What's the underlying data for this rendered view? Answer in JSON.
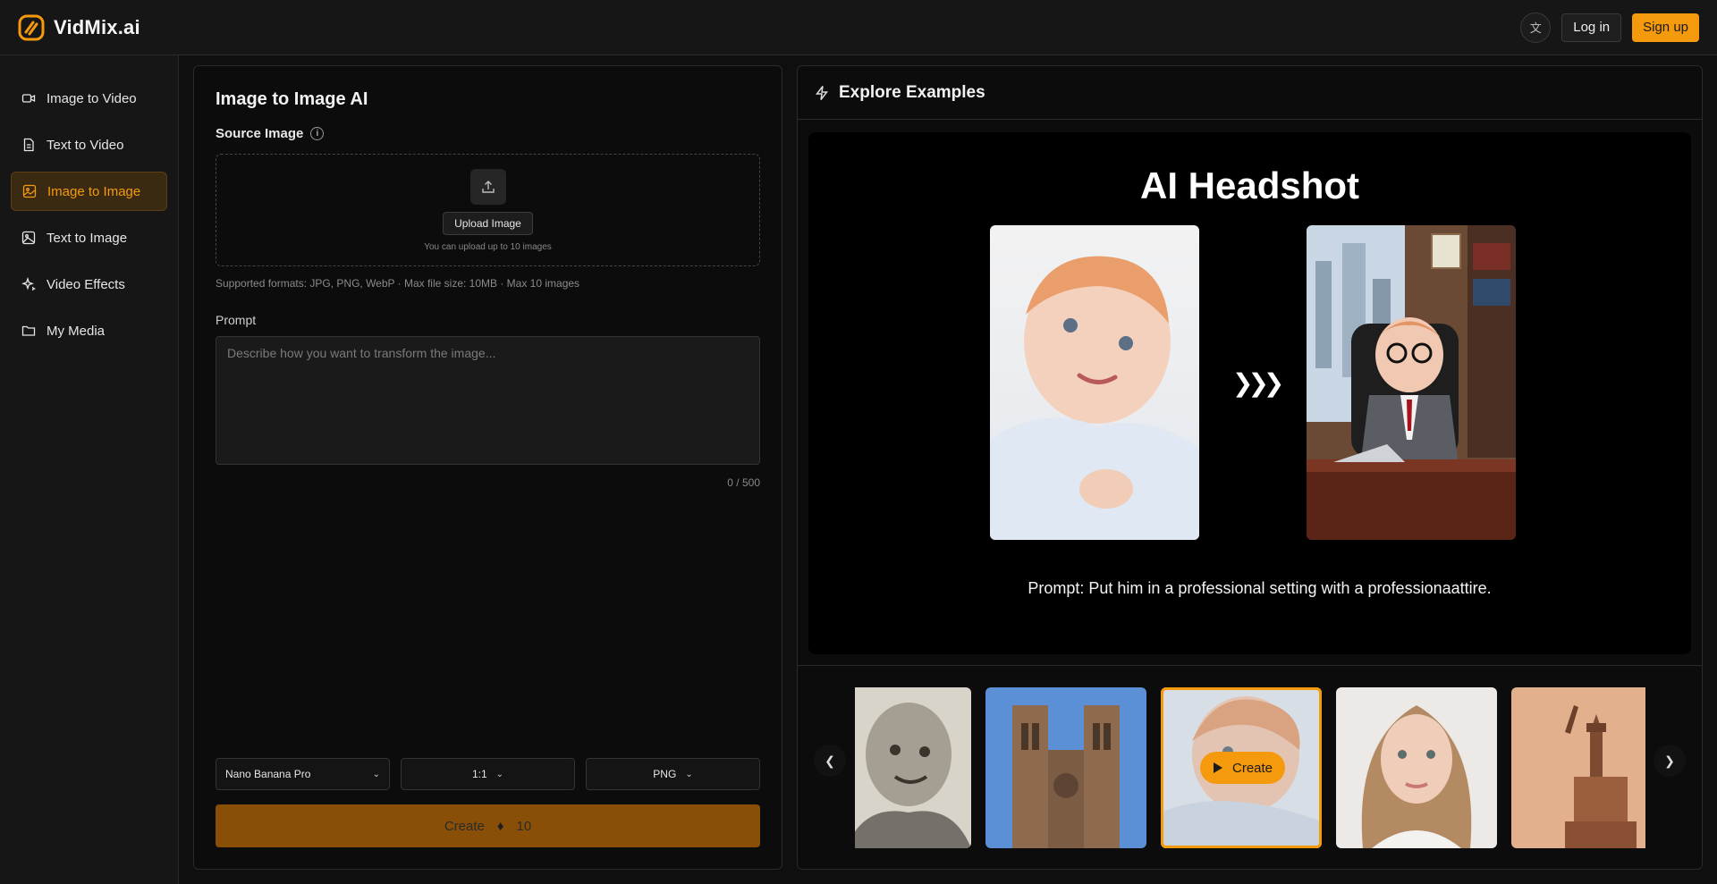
{
  "brand": {
    "name": "VidMix.ai",
    "accent": "#f59a0c"
  },
  "header": {
    "lang_icon": "translate-icon",
    "login": "Log in",
    "signup": "Sign up"
  },
  "sidebar": {
    "items": [
      {
        "label": "Image to Video",
        "icon": "video-camera-icon"
      },
      {
        "label": "Text to Video",
        "icon": "document-icon"
      },
      {
        "label": "Image to Image",
        "icon": "image-edit-icon",
        "active": true
      },
      {
        "label": "Text to Image",
        "icon": "image-icon"
      },
      {
        "label": "Video Effects",
        "icon": "sparkle-icon"
      },
      {
        "label": "My Media",
        "icon": "folder-icon"
      }
    ]
  },
  "left": {
    "title": "Image to Image AI",
    "source_label": "Source Image",
    "upload_button": "Upload Image",
    "upload_hint": "You can upload up to 10 images",
    "formats": "Supported formats: JPG, PNG, WebP · Max file size: 10MB · Max 10 images",
    "prompt_label": "Prompt",
    "prompt_placeholder": "Describe how you want to transform the image...",
    "counter": "0 / 500",
    "model": "Nano Banana Pro",
    "ratio": "1:1",
    "format": "PNG",
    "create_label": "Create",
    "credits": "10"
  },
  "right": {
    "title": "Explore Examples",
    "showcase_title": "AI Headshot",
    "showcase_prompt": "Prompt: Put him in a professional setting with a professionaattire.",
    "thumb_create": "Create"
  }
}
